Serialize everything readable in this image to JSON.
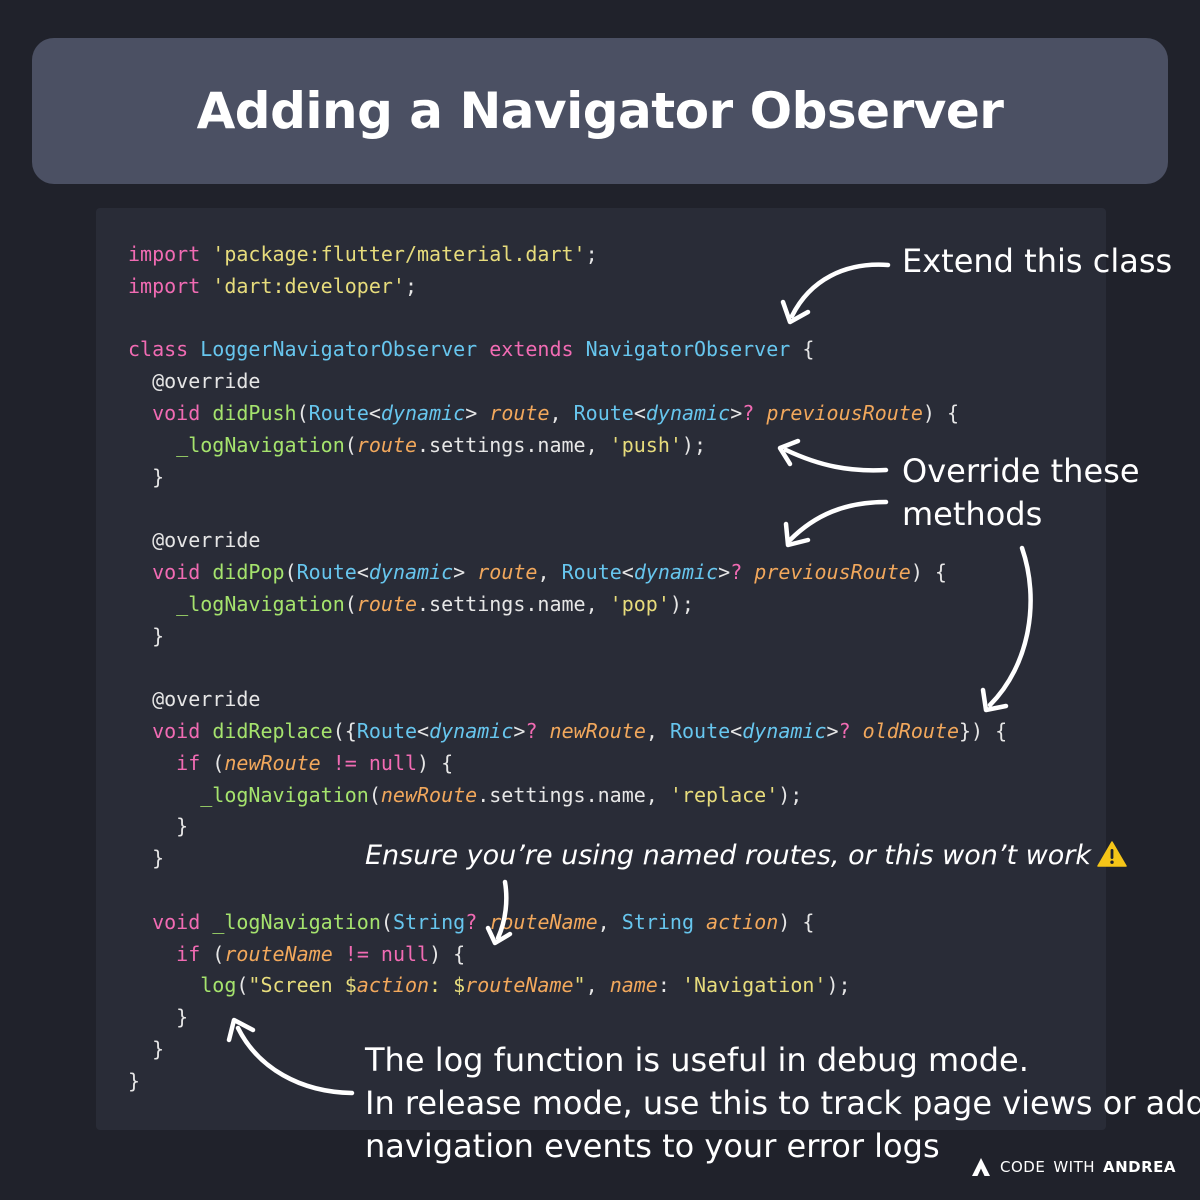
{
  "title": "Adding a Navigator Observer",
  "code_lines": [
    "import 'package:flutter/material.dart';",
    "import 'dart:developer';",
    "",
    "class LoggerNavigatorObserver extends NavigatorObserver {",
    "  @override",
    "  void didPush(Route<dynamic> route, Route<dynamic>? previousRoute) {",
    "    _logNavigation(route.settings.name, 'push');",
    "  }",
    "",
    "  @override",
    "  void didPop(Route<dynamic> route, Route<dynamic>? previousRoute) {",
    "    _logNavigation(route.settings.name, 'pop');",
    "  }",
    "",
    "  @override",
    "  void didReplace({Route<dynamic>? newRoute, Route<dynamic>? oldRoute}) {",
    "    if (newRoute != null) {",
    "      _logNavigation(newRoute.settings.name, 'replace');",
    "    }",
    "  }",
    "",
    "  void _logNavigation(String? routeName, String action) {",
    "    if (routeName != null) {",
    "      log(\"Screen $action: $routeName\", name: 'Navigation');",
    "    }",
    "  }",
    "}"
  ],
  "annotations": {
    "extend": "Extend this class",
    "override_line1": "Override these",
    "override_line2": "methods",
    "named_routes": "Ensure you’re using named routes, or this won’t work",
    "log_line1": "The log function is useful in debug mode.",
    "log_line2": "In release mode, use this to track page views or add",
    "log_line3": "navigation events to your error logs"
  },
  "brand": {
    "part1": "CODE",
    "part2": "WITH",
    "part3": "ANDREA",
    "icon": "andrea-logo-icon"
  },
  "colors": {
    "background": "#20222b",
    "title_bar": "#4b5063",
    "code_panel": "#292c37",
    "keyword": "#f16bb3",
    "string": "#e7dc7c",
    "type": "#67c6ee",
    "function": "#a5e36d",
    "parameter": "#f2a85c",
    "warning": "#f5c518"
  }
}
